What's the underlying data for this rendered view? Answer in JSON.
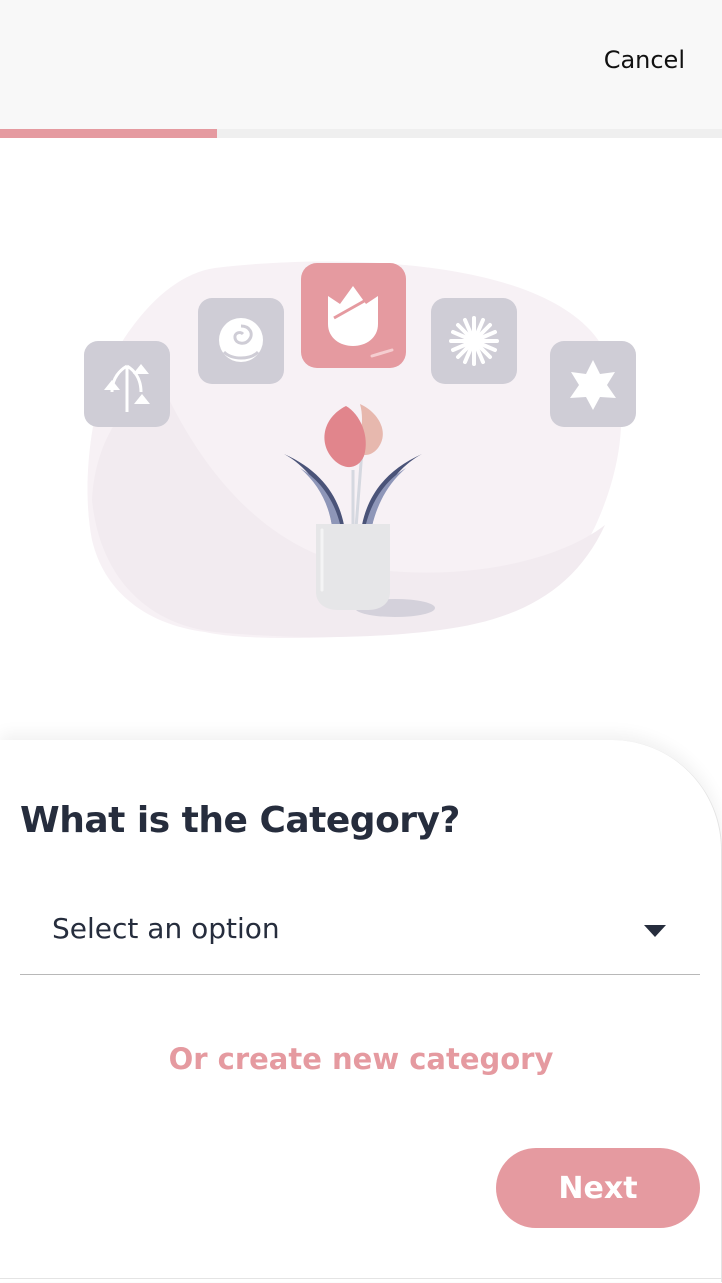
{
  "header": {
    "cancel_label": "Cancel"
  },
  "progress": {
    "fraction": 0.3,
    "color": "#e59aa0"
  },
  "illustration": {
    "icons": [
      "bellflower-icon",
      "rose-icon",
      "tulip-icon",
      "daisy-icon",
      "hibiscus-icon"
    ],
    "selected_icon": "tulip-icon"
  },
  "form": {
    "question": "What is the Category?",
    "select": {
      "value": "Select an option"
    },
    "create_link": "Or create new category",
    "next_label": "Next"
  },
  "colors": {
    "accent": "#e59aa0",
    "text_dark": "#262d3d",
    "icon_inactive": "#cfcdd6"
  }
}
